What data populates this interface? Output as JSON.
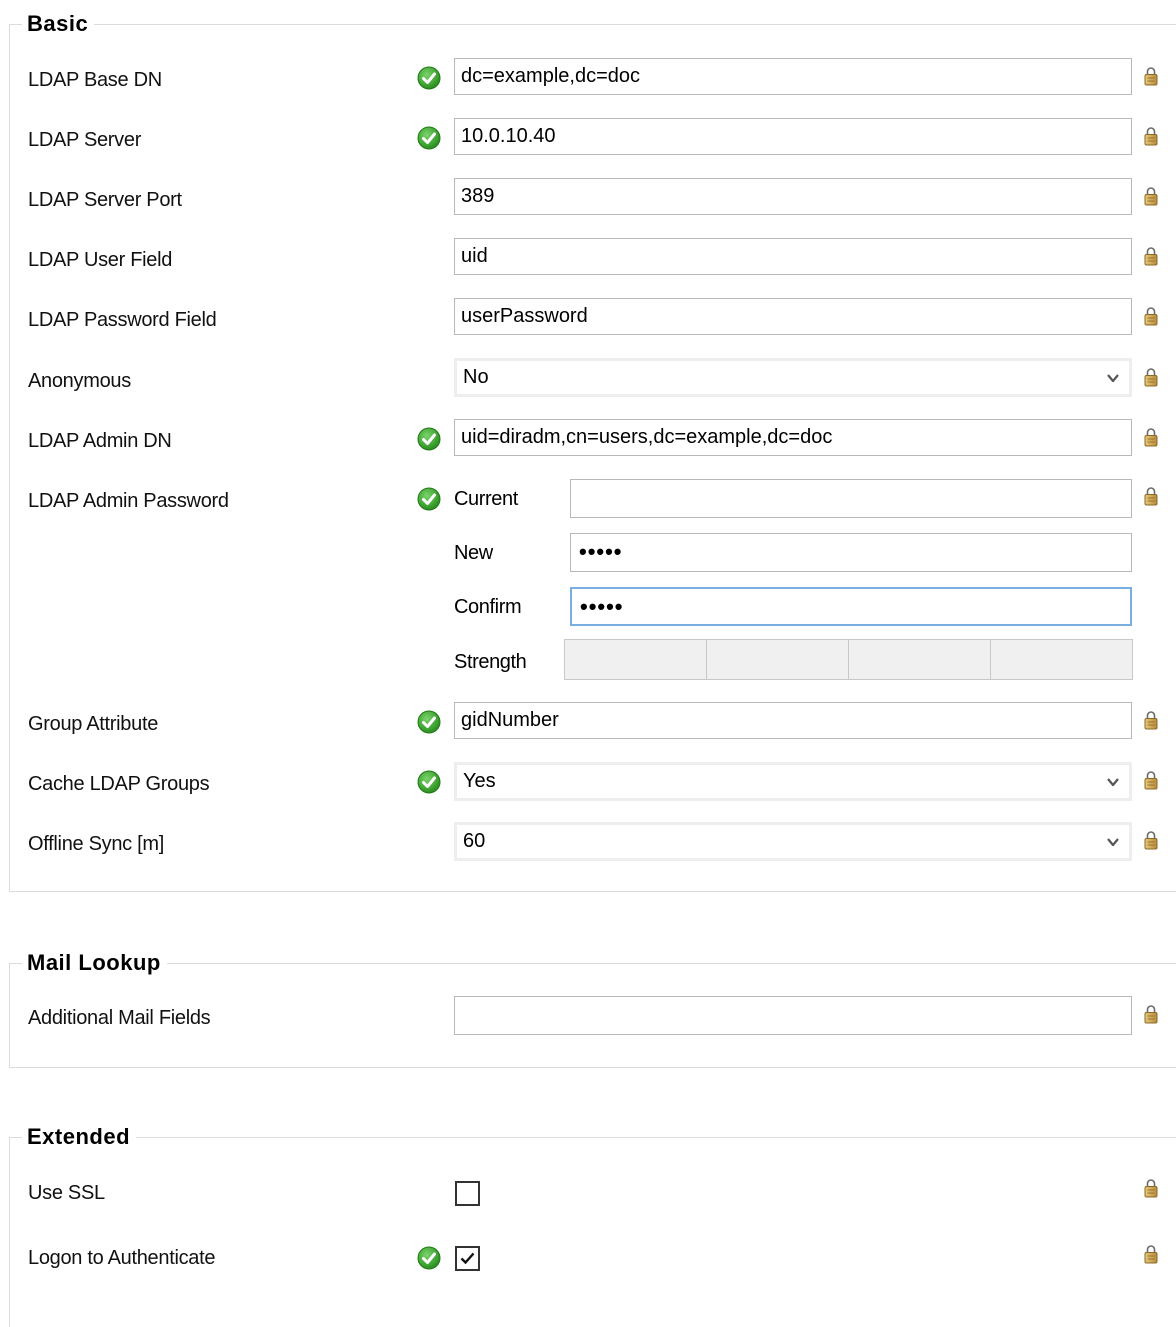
{
  "sections": {
    "basic": {
      "title": "Basic"
    },
    "mail": {
      "title": "Mail Lookup"
    },
    "extended": {
      "title": "Extended"
    }
  },
  "basic": {
    "base_dn": {
      "label": "LDAP Base DN",
      "value": "dc=example,dc=doc",
      "valid": true
    },
    "server": {
      "label": "LDAP Server",
      "value": "10.0.10.40",
      "valid": true
    },
    "port": {
      "label": "LDAP Server Port",
      "value": "389"
    },
    "user_field": {
      "label": "LDAP User Field",
      "value": "uid"
    },
    "password_field": {
      "label": "LDAP Password Field",
      "value": "userPassword"
    },
    "anonymous": {
      "label": "Anonymous",
      "value": "No"
    },
    "admin_dn": {
      "label": "LDAP Admin DN",
      "value": "uid=diradm,cn=users,dc=example,dc=doc",
      "valid": true
    },
    "admin_password": {
      "label": "LDAP Admin Password",
      "current_label": "Current",
      "current_value": "",
      "new_label": "New",
      "new_value": "•••••",
      "confirm_label": "Confirm",
      "confirm_value": "•••••",
      "strength_label": "Strength"
    },
    "group_attribute": {
      "label": "Group Attribute",
      "value": "gidNumber",
      "valid": true
    },
    "cache_groups": {
      "label": "Cache LDAP Groups",
      "value": "Yes",
      "valid": true
    },
    "offline_sync": {
      "label": "Offline Sync [m]",
      "value": "60"
    }
  },
  "mail": {
    "additional_fields": {
      "label": "Additional Mail Fields",
      "value": ""
    }
  },
  "extended": {
    "use_ssl": {
      "label": "Use SSL",
      "checked": false
    },
    "logon_authenticate": {
      "label": "Logon to Authenticate",
      "checked": true,
      "valid": true
    }
  },
  "icons": {
    "valid": "check-circle-icon",
    "lock": "lock-icon",
    "dropdown": "chevron-down-icon"
  },
  "colors": {
    "valid_green": "#3da52a",
    "lock_gold": "#c9a24a",
    "focus_border": "#7aaee0"
  }
}
